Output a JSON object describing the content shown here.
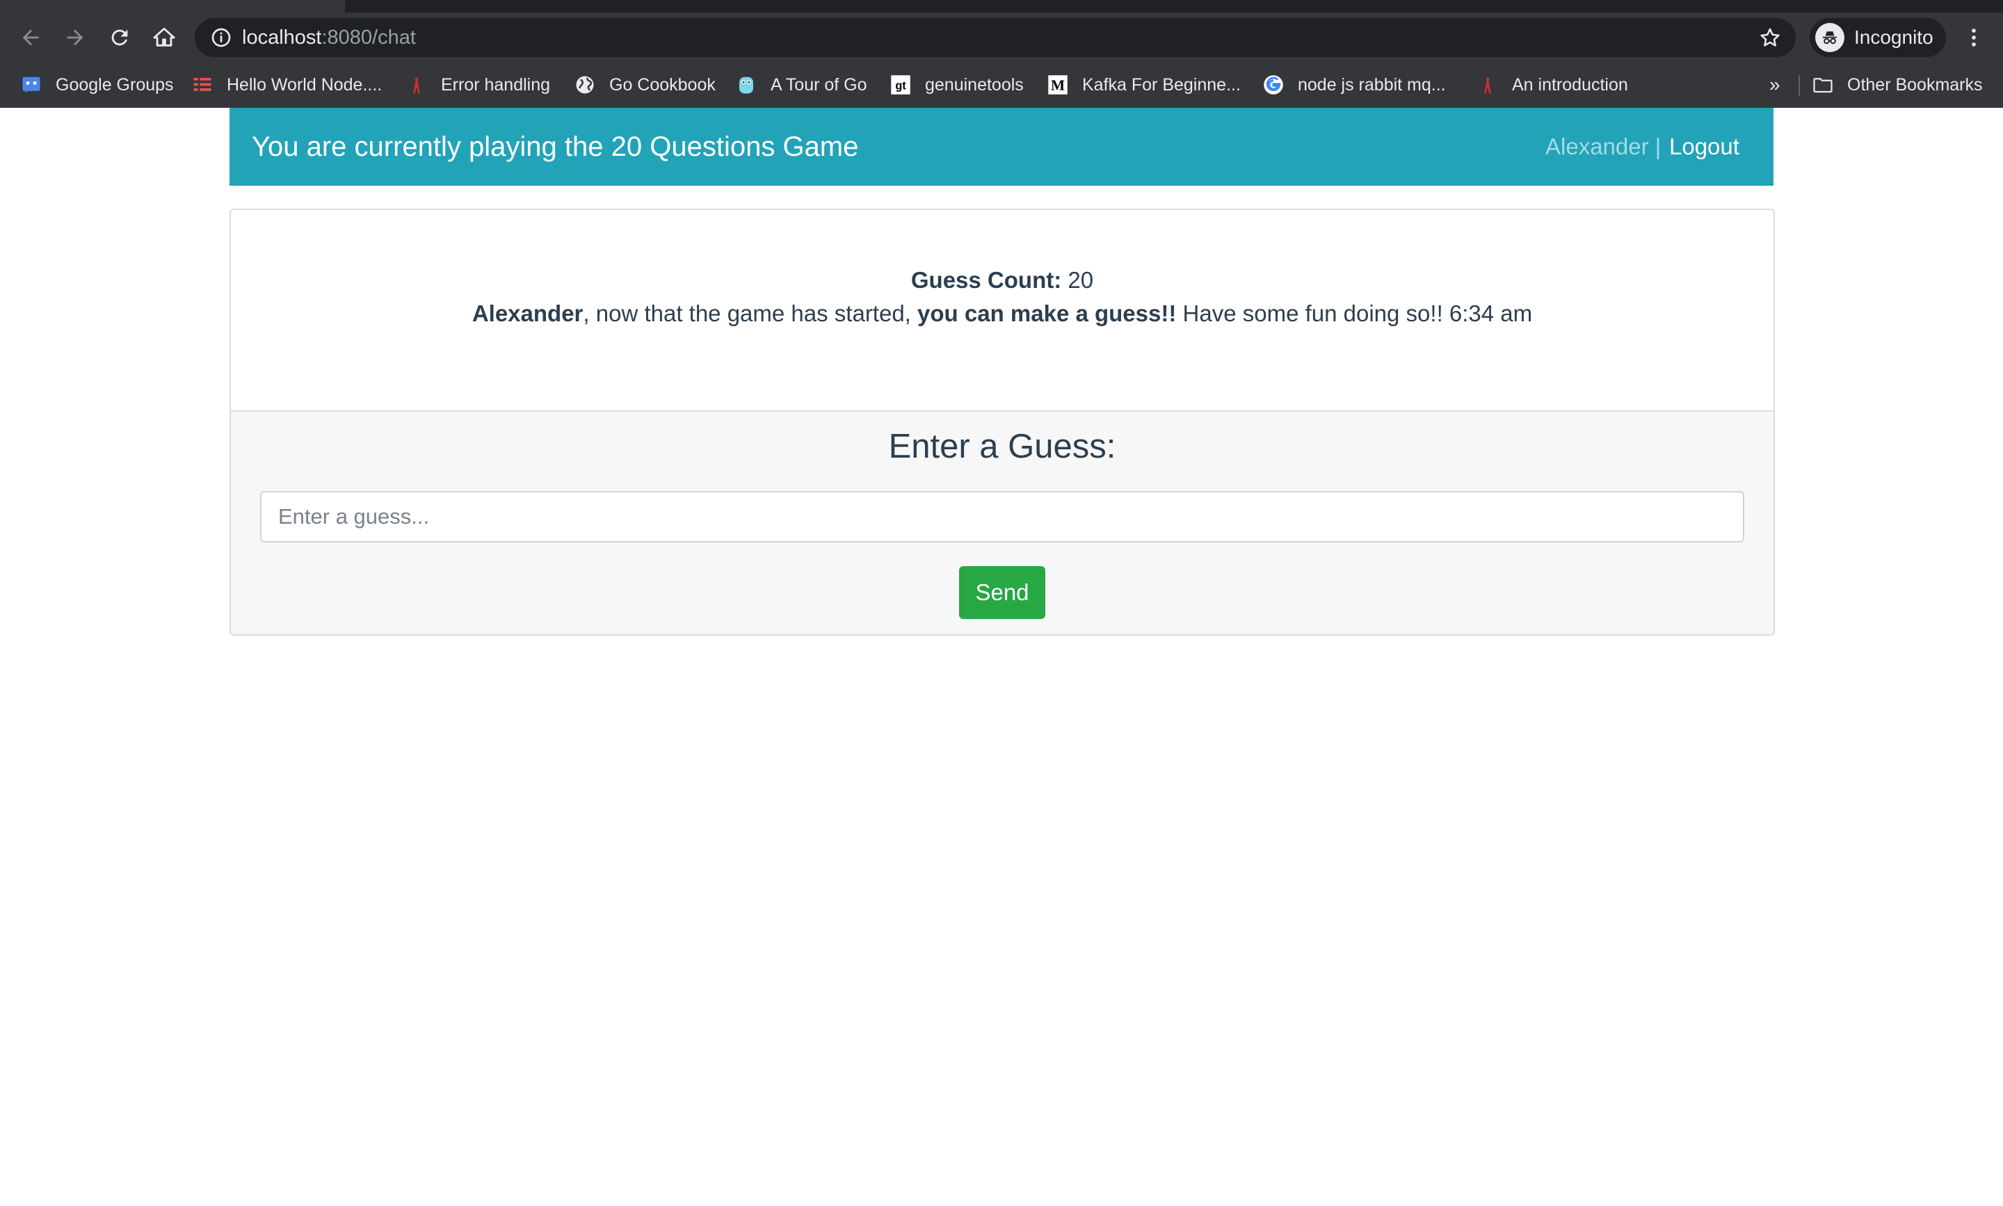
{
  "browser": {
    "url_host": "localhost",
    "url_rest": ":8080/chat",
    "profile_label": "Incognito",
    "bookmarks": [
      {
        "label": "Google Groups",
        "icon": "google-groups-icon"
      },
      {
        "label": "Hello World Node....",
        "icon": "list-icon"
      },
      {
        "label": "Error handling",
        "icon": "gopher-icon"
      },
      {
        "label": "Go Cookbook",
        "icon": "globe-icon"
      },
      {
        "label": "A Tour of Go",
        "icon": "gopher-icon"
      },
      {
        "label": "genuinetools",
        "icon": "gt-icon"
      },
      {
        "label": "Kafka For Beginne...",
        "icon": "medium-icon"
      },
      {
        "label": "node js rabbit mq...",
        "icon": "google-icon"
      },
      {
        "label": "An introduction",
        "icon": "gopher-icon"
      }
    ],
    "more_label": "»",
    "other_bookmarks_label": "Other Bookmarks"
  },
  "navbar": {
    "title": "You are currently playing the 20 Questions Game",
    "user": "Alexander |",
    "logout": "Logout"
  },
  "game": {
    "count_label": "Guess Count:",
    "count_value": "20",
    "player_name": "Alexander",
    "message_part1": ", now that the game has started,",
    "message_emphasis": "you can make a guess!!",
    "message_part2": "Have some fun doing so!! 6:34 am"
  },
  "form": {
    "title": "Enter a Guess:",
    "placeholder": "Enter a guess...",
    "value": "",
    "send_label": "Send"
  },
  "colors": {
    "navbar": "#22a3b8",
    "send_button": "#28a745",
    "text": "#2c3e50",
    "chrome": "#35363a"
  }
}
